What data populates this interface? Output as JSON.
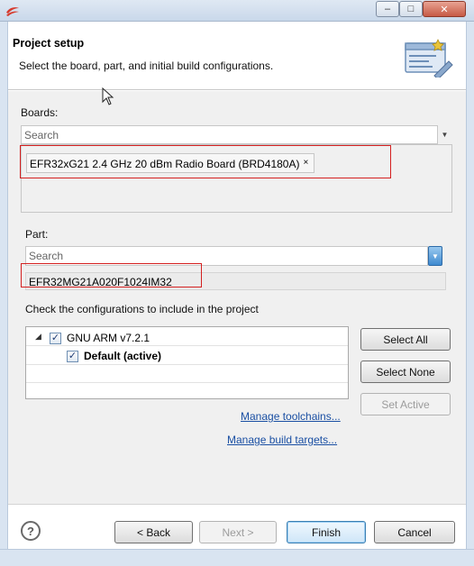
{
  "window": {
    "min_glyph": "–",
    "max_glyph": "□",
    "close_glyph": "✕",
    "accent": "#c0392b"
  },
  "header": {
    "title": "Project setup",
    "description": "Select the board, part, and initial build configurations."
  },
  "boards": {
    "label": "Boards:",
    "search_placeholder": "Search",
    "selected": [
      {
        "label": "EFR32xG21 2.4 GHz 20 dBm Radio Board (BRD4180A)",
        "remove_glyph": "×"
      }
    ]
  },
  "part": {
    "label": "Part:",
    "search_placeholder": "Search",
    "value": "EFR32MG21A020F1024IM32"
  },
  "configurations": {
    "label": "Check the configurations to include in the project",
    "toolchains": [
      {
        "label": "GNU ARM v7.2.1",
        "checked": true,
        "children": [
          {
            "label": "Default (active)",
            "checked": true
          }
        ]
      }
    ],
    "buttons": {
      "select_all": "Select All",
      "select_none": "Select None",
      "set_active": "Set Active"
    },
    "links": {
      "manage_toolchains": "Manage toolchains...",
      "manage_build_targets": "Manage build targets..."
    }
  },
  "footer": {
    "help_glyph": "?",
    "back": "< Back",
    "next": "Next >",
    "finish": "Finish",
    "cancel": "Cancel"
  },
  "icons": {
    "checkmark": "✓",
    "expand": "◢",
    "dropdown": "▼"
  }
}
